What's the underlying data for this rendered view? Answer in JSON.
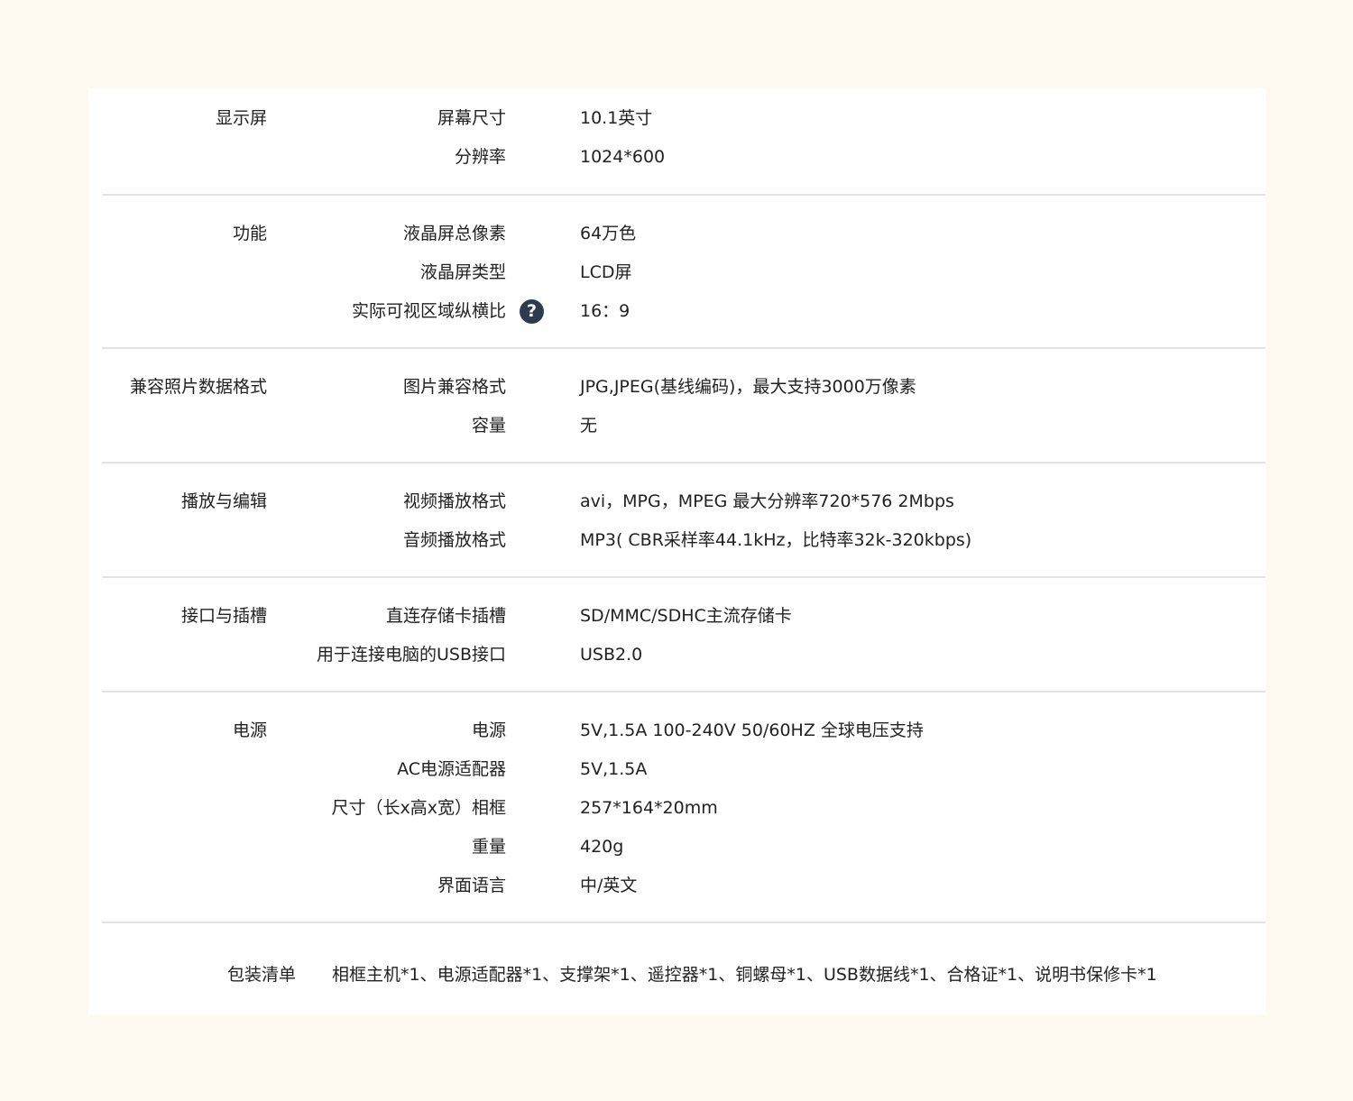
{
  "sections": [
    {
      "category": "显示屏",
      "rows": [
        {
          "label": "屏幕尺寸",
          "value": "10.1英寸"
        },
        {
          "label": "分辨率",
          "value": "1024*600"
        }
      ]
    },
    {
      "category": "功能",
      "rows": [
        {
          "label": "液晶屏总像素",
          "value": "64万色"
        },
        {
          "label": "液晶屏类型",
          "value": "LCD屏"
        },
        {
          "label": "实际可视区域纵横比",
          "value": "16：9",
          "help_icon": "question-circle-icon",
          "help_glyph": "?"
        }
      ]
    },
    {
      "category": "兼容照片数据格式",
      "rows": [
        {
          "label": "图片兼容格式",
          "value": "JPG,JPEG(基线编码)，最大支持3000万像素"
        },
        {
          "label": "容量",
          "value": "无"
        }
      ]
    },
    {
      "category": "播放与编辑",
      "rows": [
        {
          "label": "视频播放格式",
          "value": "avi，MPG，MPEG 最大分辨率720*576 2Mbps"
        },
        {
          "label": "音频播放格式",
          "value": "MP3( CBR采样率44.1kHz，比特率32k-320kbps)"
        }
      ]
    },
    {
      "category": "接口与插槽",
      "rows": [
        {
          "label": "直连存储卡插槽",
          "value": "SD/MMC/SDHC主流存储卡"
        },
        {
          "label": "用于连接电脑的USB接口",
          "value": "USB2.0"
        }
      ]
    },
    {
      "category": "电源",
      "rows": [
        {
          "label": "电源",
          "value": "5V,1.5A 100-240V 50/60HZ 全球电压支持"
        },
        {
          "label": "AC电源适配器",
          "value": "5V,1.5A"
        },
        {
          "label": "尺寸（长x高x宽）相框",
          "value": "257*164*20mm"
        },
        {
          "label": "重量",
          "value": "420g"
        },
        {
          "label": "界面语言",
          "value": "中/英文"
        }
      ]
    }
  ],
  "package": {
    "label": "包装清单",
    "value": "相框主机*1、电源适配器*1、支撑架*1、遥控器*1、铜螺母*1、USB数据线*1、合格证*1、说明书保修卡*1"
  }
}
